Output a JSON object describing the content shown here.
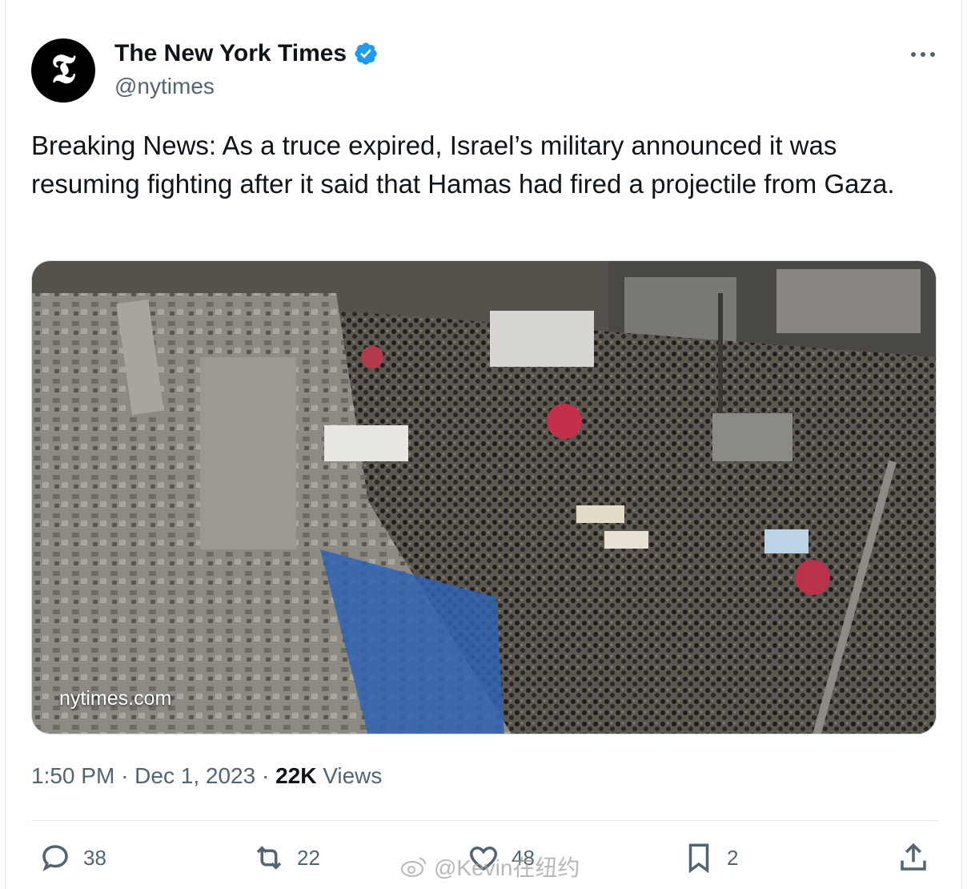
{
  "tweet": {
    "author_name": "The New York Times",
    "author_handle": "@nytimes",
    "avatar_letter": "𝕿",
    "text": "Breaking News: As a truce expired, Israel’s military announced it was resuming fighting after it said that Hamas had fired a projectile from Gaza.",
    "media_caption": "nytimes.com",
    "time": "1:50 PM",
    "date": "Dec 1, 2023",
    "views_count": "22K",
    "views_label": "Views"
  },
  "actions": {
    "replies": "38",
    "reposts": "22",
    "likes": "48",
    "bookmarks": "2"
  },
  "watermark": "@Kevin在纽约",
  "colors": {
    "verified": "#1d9bf0",
    "text_secondary": "#536471",
    "divider": "#e6ecf0"
  },
  "icons": [
    "nyt-logo-icon",
    "verified-badge-icon",
    "more-icon",
    "reply-icon",
    "repost-icon",
    "like-icon",
    "bookmark-icon",
    "share-icon"
  ]
}
